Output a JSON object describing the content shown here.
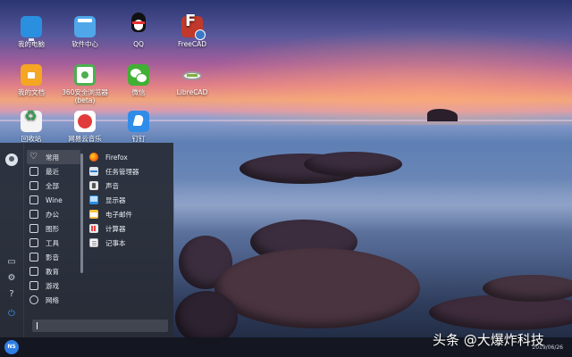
{
  "desktop": {
    "icons": [
      {
        "label": "我的电脑",
        "icon": "computer-icon"
      },
      {
        "label": "软件中心",
        "icon": "software-center-icon"
      },
      {
        "label": "QQ",
        "icon": "qq-icon"
      },
      {
        "label": "FreeCAD",
        "icon": "freecad-icon"
      },
      {
        "label": "我的文档",
        "icon": "documents-folder-icon"
      },
      {
        "label": "360安全浏览器 (beta)",
        "icon": "360-browser-icon"
      },
      {
        "label": "微信",
        "icon": "wechat-icon"
      },
      {
        "label": "LibreCAD",
        "icon": "librecad-icon"
      },
      {
        "label": "回收站",
        "icon": "recycle-bin-icon"
      },
      {
        "label": "网易云音乐",
        "icon": "netease-music-icon"
      },
      {
        "label": "钉钉",
        "icon": "dingtalk-icon"
      }
    ]
  },
  "start_menu": {
    "categories": [
      {
        "label": "常用",
        "icon": "heart-icon",
        "active": true
      },
      {
        "label": "最近",
        "icon": "recent-icon"
      },
      {
        "label": "全部",
        "icon": "all-apps-icon"
      },
      {
        "label": "Wine",
        "icon": "wine-icon"
      },
      {
        "label": "办公",
        "icon": "office-icon"
      },
      {
        "label": "图形",
        "icon": "graphics-icon"
      },
      {
        "label": "工具",
        "icon": "tools-icon"
      },
      {
        "label": "影音",
        "icon": "media-icon"
      },
      {
        "label": "教育",
        "icon": "education-icon"
      },
      {
        "label": "游戏",
        "icon": "games-icon"
      },
      {
        "label": "网络",
        "icon": "network-icon"
      }
    ],
    "apps": [
      {
        "label": "Firefox",
        "icon": "firefox-icon"
      },
      {
        "label": "任务管理器",
        "icon": "task-manager-icon"
      },
      {
        "label": "声音",
        "icon": "sound-icon"
      },
      {
        "label": "显示器",
        "icon": "display-icon"
      },
      {
        "label": "电子邮件",
        "icon": "mail-icon"
      },
      {
        "label": "计算器",
        "icon": "calculator-icon"
      },
      {
        "label": "记事本",
        "icon": "notepad-icon"
      }
    ],
    "search_value": ""
  },
  "taskbar": {
    "start_label": "NS",
    "date": "2019/06/26"
  },
  "watermark": "头条 @大爆炸科技"
}
